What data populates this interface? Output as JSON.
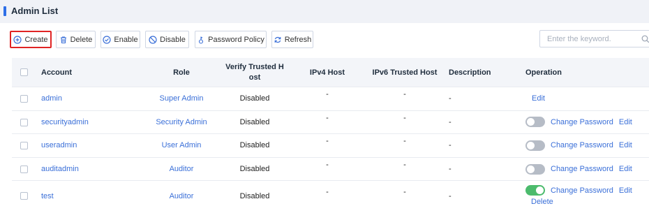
{
  "page": {
    "title": "Admin List"
  },
  "toolbar": {
    "create": "Create",
    "delete": "Delete",
    "enable": "Enable",
    "disable": "Disable",
    "password_policy": "Password Policy",
    "refresh": "Refresh",
    "search_placeholder": "Enter the keyword."
  },
  "table": {
    "headers": {
      "account": "Account",
      "role": "Role",
      "verify_line1": "Verify Trusted H",
      "verify_line2": "ost",
      "ipv4": "IPv4 Host",
      "ipv6": "IPv6 Trusted Host",
      "description": "Description",
      "operation": "Operation"
    },
    "rows": [
      {
        "account": "admin",
        "role": "Super Admin",
        "verify": "Disabled",
        "ipv4": "-",
        "ipv6": "-",
        "description": "-",
        "edit": "Edit"
      },
      {
        "account": "securityadmin",
        "role": "Security Admin",
        "verify": "Disabled",
        "ipv4": "-",
        "ipv6": "-",
        "description": "-",
        "toggle_on": false,
        "change_password": "Change Password",
        "edit": "Edit"
      },
      {
        "account": "useradmin",
        "role": "User Admin",
        "verify": "Disabled",
        "ipv4": "-",
        "ipv6": "-",
        "description": "-",
        "toggle_on": false,
        "change_password": "Change Password",
        "edit": "Edit"
      },
      {
        "account": "auditadmin",
        "role": "Auditor",
        "verify": "Disabled",
        "ipv4": "-",
        "ipv6": "-",
        "description": "-",
        "toggle_on": false,
        "change_password": "Change Password",
        "edit": "Edit"
      },
      {
        "account": "test",
        "role": "Auditor",
        "verify": "Disabled",
        "ipv4": "-",
        "ipv6": "-",
        "description": "-",
        "toggle_on": true,
        "change_password": "Change Password",
        "edit": "Edit",
        "delete": "Delete"
      }
    ]
  },
  "colors": {
    "accent": "#2d6fe8",
    "link": "#3a6fd8",
    "toggle_on": "#4cbb6d",
    "toggle_off": "#b6bcc6",
    "highlight_border": "#e02424"
  }
}
